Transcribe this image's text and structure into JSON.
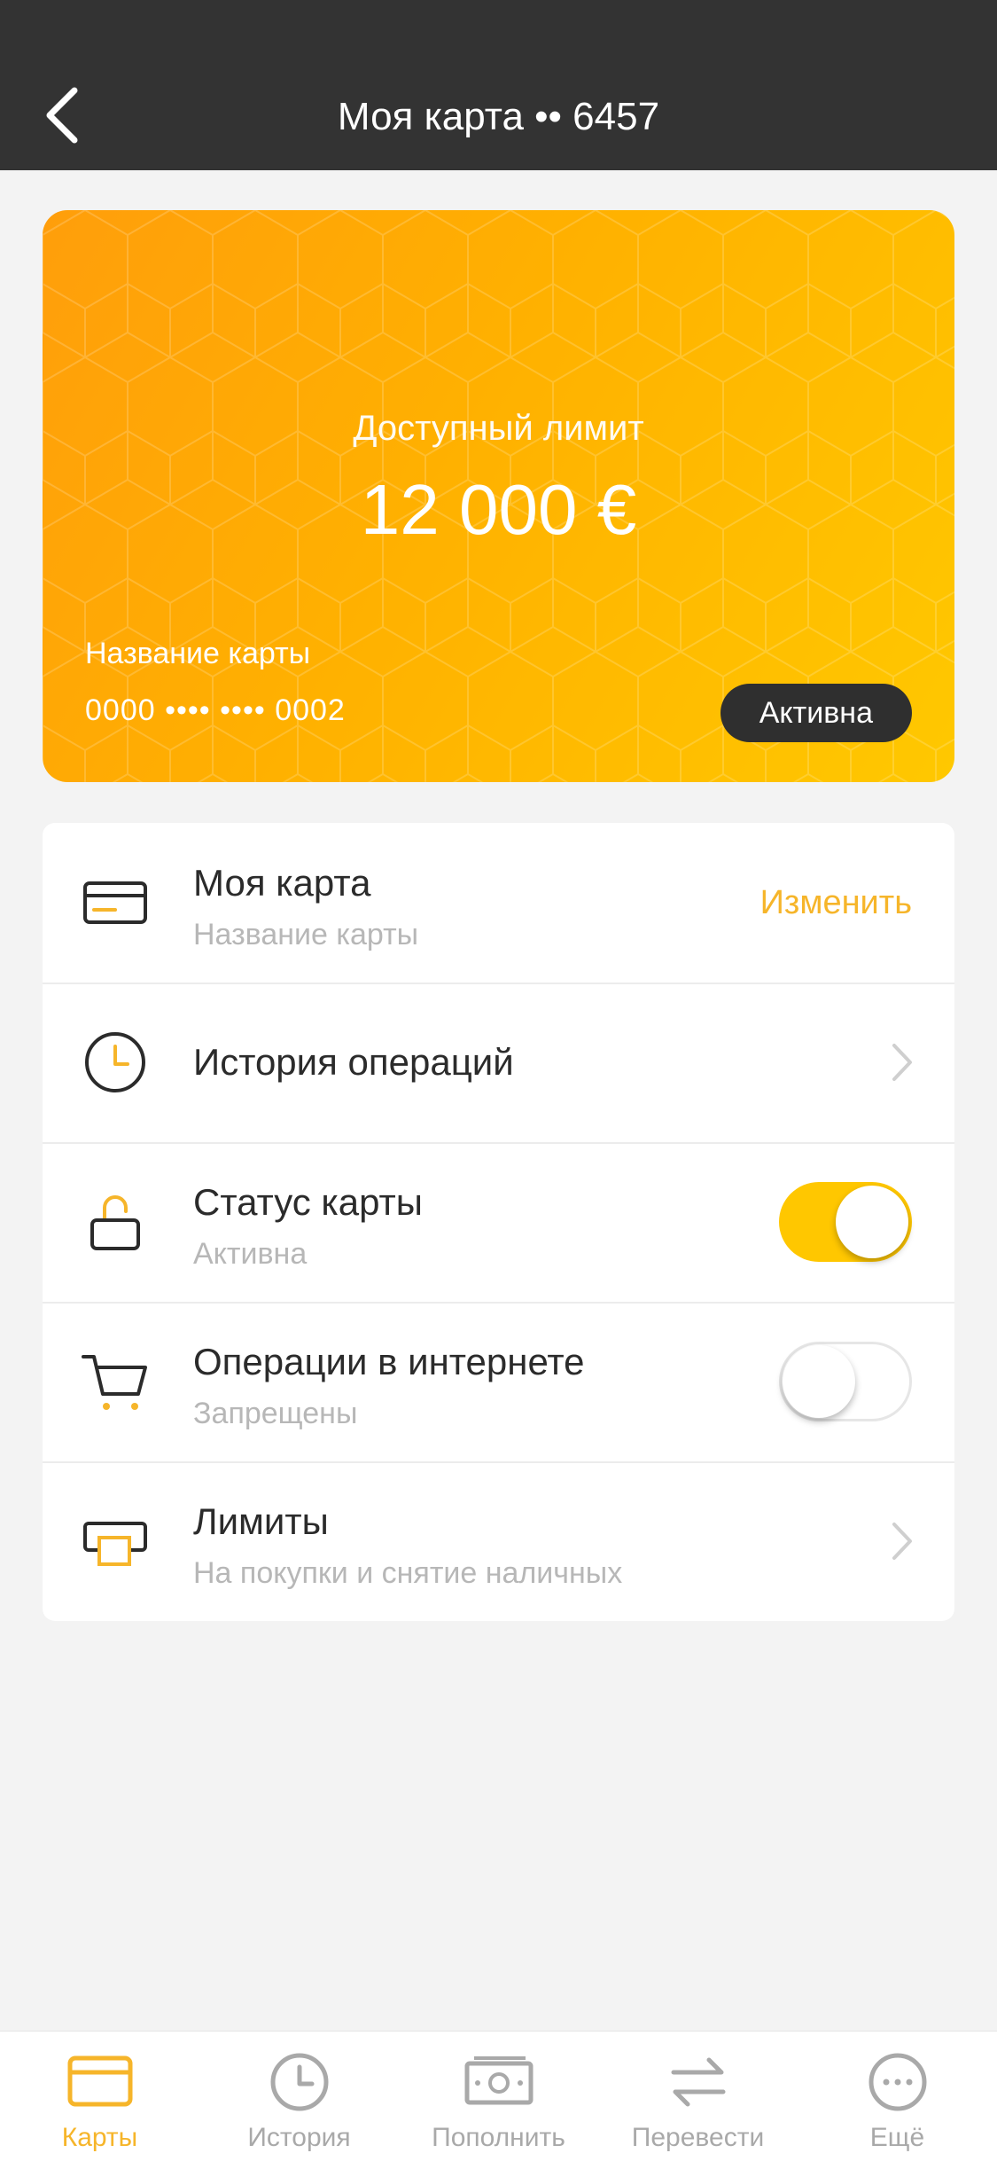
{
  "header": {
    "title": "Моя карта •• 6457",
    "back_icon": "chevron-left-icon"
  },
  "card": {
    "limit_label": "Доступный лимит",
    "limit_value": "12 000 €",
    "name": "Название карты",
    "number": "0000 •••• •••• 0002",
    "status": "Активна",
    "gradient_colors": [
      "#ff9e0b",
      "#ffc800"
    ]
  },
  "list": {
    "items": [
      {
        "icon": "credit-card-icon",
        "title": "Моя карта",
        "subtitle": "Название карты",
        "action": "Изменить"
      },
      {
        "icon": "clock-icon",
        "title": "История операций",
        "control": "chevron"
      },
      {
        "icon": "unlock-icon",
        "title": "Статус карты",
        "subtitle": "Активна",
        "control": "toggle",
        "toggle_on": true
      },
      {
        "icon": "cart-icon",
        "title": "Операции в интернете",
        "subtitle": "Запрещены",
        "control": "toggle",
        "toggle_on": false
      },
      {
        "icon": "atm-icon",
        "title": "Лимиты",
        "subtitle": "На покупки и снятие наличных",
        "control": "chevron"
      }
    ]
  },
  "tabbar": {
    "active": "Карты",
    "tabs": [
      {
        "label": "Карты",
        "icon": "card-icon"
      },
      {
        "label": "История",
        "icon": "clock-icon"
      },
      {
        "label": "Пополнить",
        "icon": "banknote-icon"
      },
      {
        "label": "Перевести",
        "icon": "transfer-icon"
      },
      {
        "label": "Ещё",
        "icon": "more-icon"
      }
    ]
  },
  "colors": {
    "header_bg": "#333333",
    "accent": "#f6b52a",
    "toggle_on": "#ffc700",
    "page_bg": "#f3f3f3"
  }
}
